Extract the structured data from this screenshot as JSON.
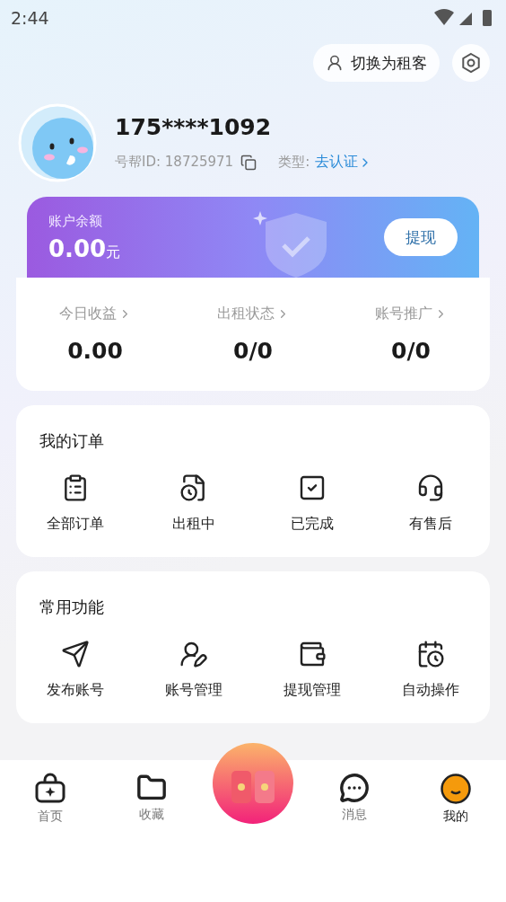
{
  "status_bar": {
    "time": "2:44"
  },
  "header": {
    "switch_button": "切换为租客"
  },
  "profile": {
    "phone": "175****1092",
    "id_label": "号帮ID: 18725971",
    "type_label": "类型:",
    "verify_link": "去认证"
  },
  "balance": {
    "label": "账户余额",
    "amount": "0.00",
    "unit": "元",
    "withdraw_button": "提现"
  },
  "stats": [
    {
      "label": "今日收益",
      "value": "0.00"
    },
    {
      "label": "出租状态",
      "value": "0/0"
    },
    {
      "label": "账号推广",
      "value": "0/0"
    }
  ],
  "orders": {
    "title": "我的订单",
    "items": [
      {
        "label": "全部订单"
      },
      {
        "label": "出租中"
      },
      {
        "label": "已完成"
      },
      {
        "label": "有售后"
      }
    ]
  },
  "functions": {
    "title": "常用功能",
    "items": [
      {
        "label": "发布账号"
      },
      {
        "label": "账号管理"
      },
      {
        "label": "提现管理"
      },
      {
        "label": "自动操作"
      }
    ]
  },
  "nav": [
    {
      "label": "首页",
      "kind": "tab",
      "selected": false
    },
    {
      "label": "收藏",
      "kind": "tab",
      "selected": false
    },
    {
      "kind": "center"
    },
    {
      "label": "消息",
      "kind": "tab",
      "selected": false
    },
    {
      "label": "我的",
      "kind": "tab",
      "selected": true
    }
  ]
}
